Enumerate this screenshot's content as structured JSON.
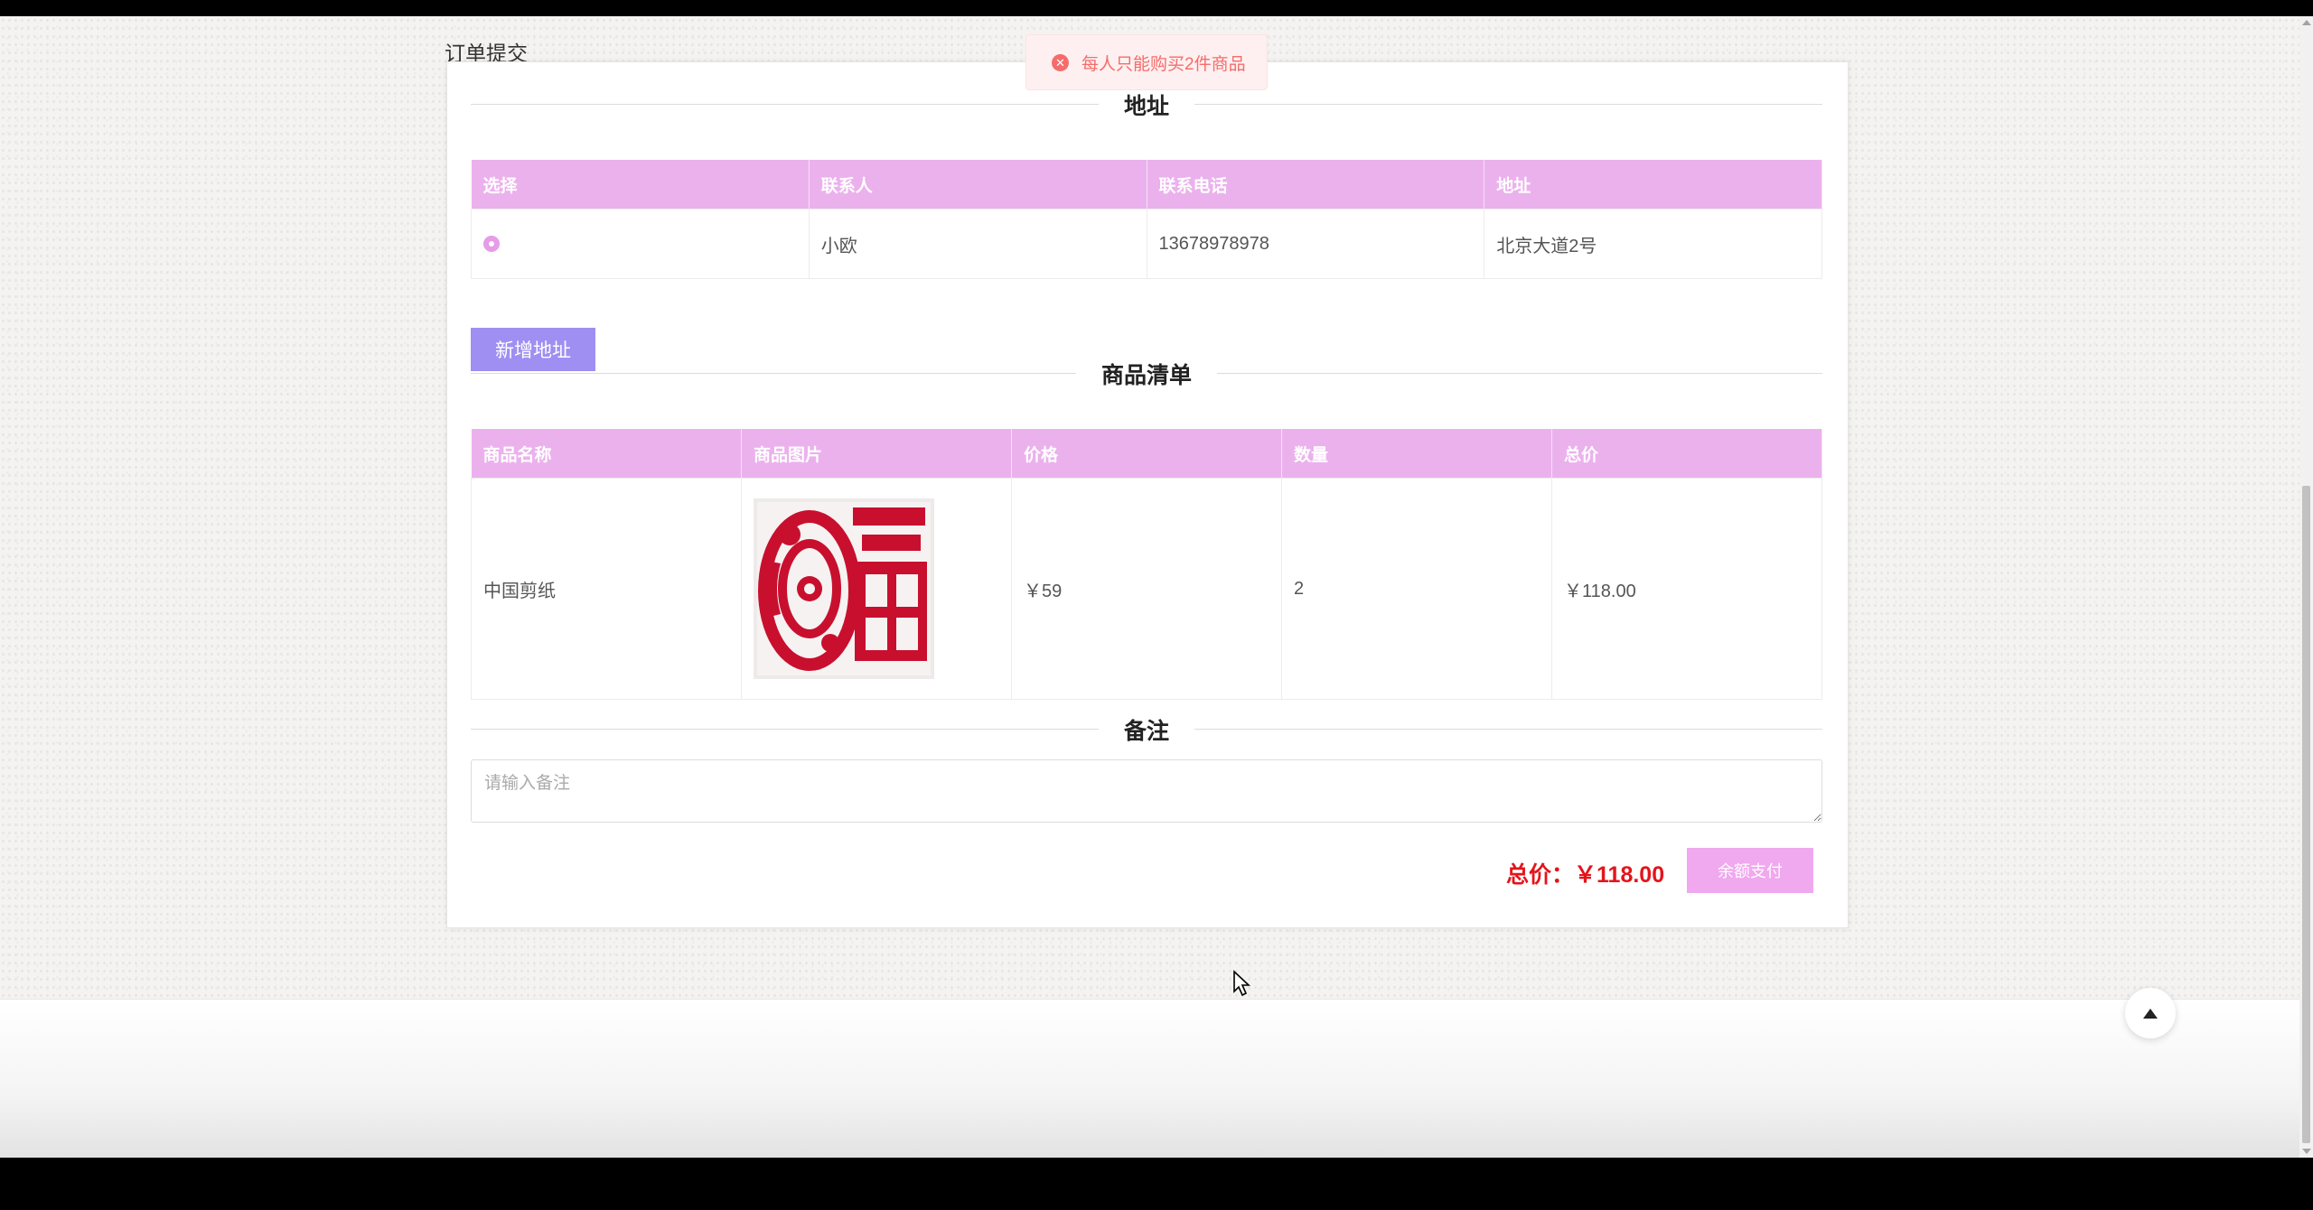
{
  "page": {
    "title": "订单提交"
  },
  "toast": {
    "message": "每人只能购买2件商品",
    "icon": "close-circle-icon",
    "color": "#f56c6c"
  },
  "address_section": {
    "title": "地址",
    "columns": [
      "选择",
      "联系人",
      "联系电话",
      "地址"
    ],
    "rows": [
      {
        "selected": true,
        "contact": "小欧",
        "phone": "13678978978",
        "address": "北京大道2号"
      }
    ],
    "add_button": "新增地址"
  },
  "goods_section": {
    "title": "商品清单",
    "columns": [
      "商品名称",
      "商品图片",
      "价格",
      "数量",
      "总价"
    ],
    "rows": [
      {
        "name": "中国剪纸",
        "image": "red-paper-cut-dragon-fu",
        "price": "￥59",
        "quantity": "2",
        "total": "￥118.00"
      }
    ]
  },
  "remark_section": {
    "title": "备注",
    "placeholder": "请输入备注",
    "value": ""
  },
  "summary": {
    "total_label": "总价：",
    "total_value": "￥118.00",
    "pay_button": "余额支付"
  },
  "colors": {
    "table_header": "#ebb1ed",
    "add_button": "#9f8ff2",
    "pay_button": "#f0a8ee",
    "total_text": "#e4141b"
  }
}
